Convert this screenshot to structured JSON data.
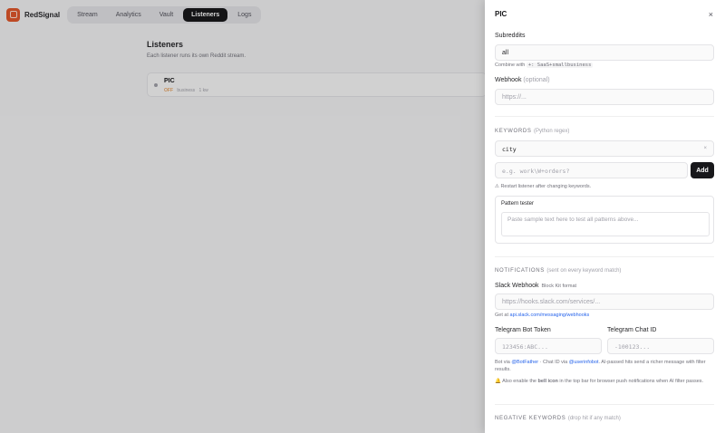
{
  "app": {
    "brand": "RedSignal",
    "tabs": [
      {
        "label": "Stream"
      },
      {
        "label": "Analytics"
      },
      {
        "label": "Vault"
      },
      {
        "label": "Listeners"
      },
      {
        "label": "Logs"
      }
    ],
    "active_tab": "Listeners"
  },
  "main": {
    "title": "Listeners",
    "subtitle": "Each listener runs its own Reddit stream.",
    "card": {
      "name": "PIC",
      "status": "OFF",
      "sub": "business",
      "count": "1 kw"
    }
  },
  "panel": {
    "title": "PIC",
    "close": "×",
    "subreddits": {
      "label": "Subreddits",
      "value": "all",
      "hint_prefix": "Combine with",
      "hint_code": "+: SaaS+smallbusiness"
    },
    "webhook": {
      "label": "Webhook",
      "optional": "(optional)",
      "placeholder": "https://..."
    },
    "keywords": {
      "heading": "KEYWORDS",
      "heading_note": "(Python regex)",
      "items": [
        "city"
      ],
      "remove": "×",
      "input_placeholder": "e.g. work\\W+orders?",
      "add_label": "Add",
      "restart_note": "⚠ Restart listener after changing keywords."
    },
    "tester": {
      "title": "Pattern tester",
      "placeholder": "Paste sample text here to test all patterns above..."
    },
    "notifications": {
      "heading": "NOTIFICATIONS",
      "heading_note": "(sent on every keyword match)",
      "slack_label": "Slack Webhook",
      "slack_hint": "Block Kit format",
      "slack_placeholder": "https://hooks.slack.com/services/...",
      "slack_help_prefix": "Get at",
      "slack_help_link": "api.slack.com/messaging/webhooks",
      "tg_token_label": "Telegram Bot Token",
      "tg_token_placeholder": "123456:ABC...",
      "tg_chat_label": "Telegram Chat ID",
      "tg_chat_placeholder": "-100123...",
      "tg_help_1": "Bot via",
      "tg_help_botfather": "@BotFather",
      "tg_help_2": "· Chat ID via",
      "tg_help_userinfobot": "@userinfobot",
      "tg_help_3": ". AI-passed hits send a richer message with filter results.",
      "bell_note_1": "🔔 Also enable the",
      "bell_note_bold": "bell icon",
      "bell_note_2": "in the top bar for browser push notifications when AI filter passes."
    },
    "negative": {
      "heading": "NEGATIVE KEYWORDS",
      "heading_note": "(drop hit if any match)"
    }
  },
  "colors": {
    "accent": "#e2582c",
    "primary": "#18181b",
    "link": "#2563eb",
    "warning": "#e7a463"
  }
}
